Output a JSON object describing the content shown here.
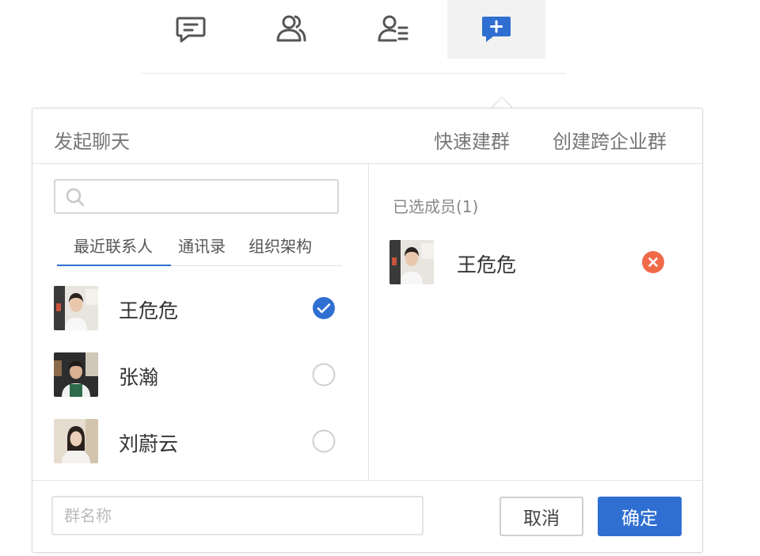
{
  "nav": {
    "icons": [
      "chat-icon",
      "contacts-icon",
      "contact-list-icon",
      "new-chat-icon"
    ],
    "active_index": 3
  },
  "panel": {
    "title": "发起聊天",
    "quick_group": "快速建群",
    "cross_company_group": "创建跨企业群"
  },
  "search": {
    "placeholder": ""
  },
  "tabs": [
    "最近联系人",
    "通讯录",
    "组织架构"
  ],
  "contacts": [
    {
      "name": "王危危",
      "selected": true
    },
    {
      "name": "张瀚",
      "selected": false
    },
    {
      "name": "刘蔚云",
      "selected": false
    }
  ],
  "selected_panel": {
    "title": "已选成员(1)",
    "members": [
      {
        "name": "王危危"
      }
    ]
  },
  "footer": {
    "group_name_placeholder": "群名称",
    "cancel": "取消",
    "confirm": "确定"
  },
  "colors": {
    "accent": "#2f6fd1",
    "remove": "#f06a4a",
    "icon": "#555555"
  }
}
